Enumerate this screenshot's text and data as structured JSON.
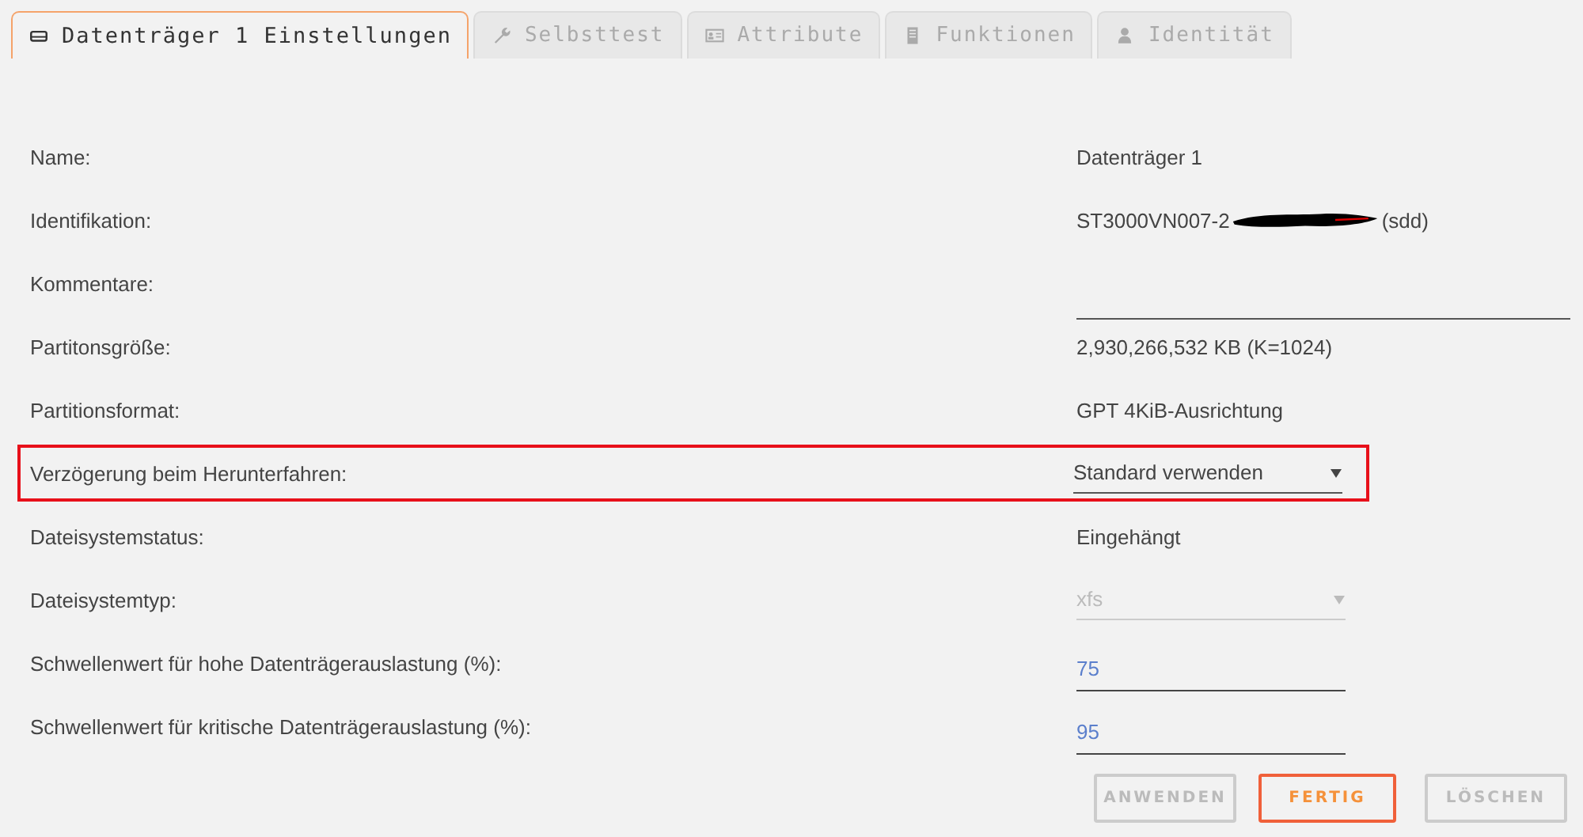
{
  "tabs": [
    {
      "label": "Datenträger 1 Einstellungen",
      "selected": true
    },
    {
      "label": "Selbsttest",
      "selected": false
    },
    {
      "label": "Attribute",
      "selected": false
    },
    {
      "label": "Funktionen",
      "selected": false
    },
    {
      "label": "Identität",
      "selected": false
    }
  ],
  "rows": [
    {
      "label": "Name:",
      "kind": "text",
      "value": "Datenträger 1"
    },
    {
      "label": "Identifikation:",
      "kind": "redacted",
      "value": "ST3000VN007-2",
      "suffix": "(sdd)"
    },
    {
      "label": "Kommentare:",
      "kind": "wide-field"
    },
    {
      "label": "Partitonsgröße:",
      "kind": "text",
      "value": "2,930,266,532 KB (K=1024)"
    },
    {
      "label": "Partitionsformat:",
      "kind": "text",
      "value": "GPT 4KiB-Ausrichtung"
    },
    {
      "label": "Verzögerung beim Herunterfahren:",
      "kind": "select",
      "value": "Standard verwenden",
      "disabled": false,
      "highlighted": true
    },
    {
      "label": "Dateisystemstatus:",
      "kind": "text",
      "value": "Eingehängt"
    },
    {
      "label": "Dateisystemtyp:",
      "kind": "select",
      "value": "xfs",
      "disabled": true
    },
    {
      "label": "Schwellenwert für hohe Datenträgerauslastung (%):",
      "kind": "number",
      "value": "75"
    },
    {
      "label": "Schwellenwert für kritische Datenträgerauslastung (%):",
      "kind": "number",
      "value": "95"
    }
  ],
  "buttons": [
    {
      "label": "ANWENDEN",
      "disabled": true,
      "primary": false
    },
    {
      "label": "FERTIG",
      "disabled": false,
      "primary": true
    },
    {
      "label": "LÖSCHEN",
      "disabled": true,
      "primary": false
    }
  ]
}
